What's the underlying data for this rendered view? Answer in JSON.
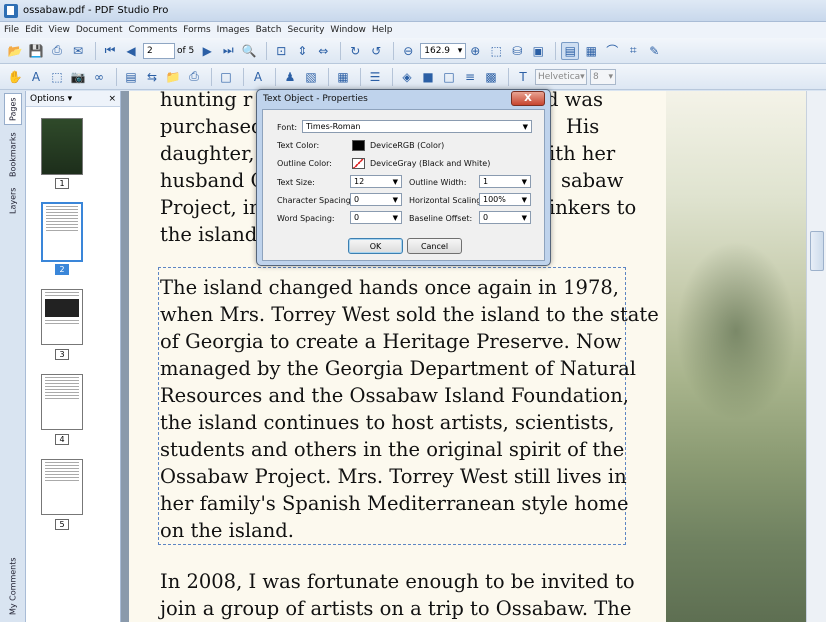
{
  "window": {
    "title": "ossabaw.pdf - PDF Studio Pro"
  },
  "menu": [
    "File",
    "Edit",
    "View",
    "Document",
    "Comments",
    "Forms",
    "Images",
    "Batch",
    "Security",
    "Window",
    "Help"
  ],
  "toolbar": {
    "page_current": "2",
    "page_of": "of 5",
    "zoom": "162.9",
    "font_name": "Helvetica",
    "font_size": "8"
  },
  "side_tabs": [
    "Pages",
    "Bookmarks",
    "Layers",
    "My Comments"
  ],
  "panel": {
    "options_label": "Options",
    "close_glyph": "×"
  },
  "thumbnails": [
    {
      "num": "1"
    },
    {
      "num": "2"
    },
    {
      "num": "3"
    },
    {
      "num": "4"
    },
    {
      "num": "5"
    }
  ],
  "document": {
    "top_lines": [
      "hunting r",
      "purchased",
      "daughter,",
      "husband C",
      "Project, in",
      "the island"
    ],
    "right_fragments": [
      "d was",
      "His",
      "ith her",
      "sabaw",
      "inkers to"
    ],
    "selected_lines": [
      "The island changed hands once again in 1978,",
      "when Mrs. Torrey West sold the island to the state",
      "of Georgia to create a Heritage Preserve. Now",
      "managed by the Georgia Department of Natural",
      "Resources and the Ossabaw Island Foundation,",
      "the island continues to host artists, scientists,",
      "students and others in the original spirit of the",
      "Ossabaw Project. Mrs. Torrey West still lives in",
      "her family's Spanish Mediterranean style home",
      "on the island."
    ],
    "bottom_lines": [
      "In 2008, I was fortunate enough to be invited to",
      "join a group of artists on a trip to Ossabaw. The"
    ]
  },
  "dialog": {
    "title": "Text Object - Properties",
    "close": "X",
    "font_label": "Font:",
    "font_value": "Times-Roman",
    "text_color_label": "Text Color:",
    "text_color_value": "DeviceRGB (Color)",
    "outline_color_label": "Outline Color:",
    "outline_color_value": "DeviceGray (Black and White)",
    "text_size_label": "Text Size:",
    "text_size_value": "12",
    "outline_width_label": "Outline Width:",
    "outline_width_value": "1",
    "char_spacing_label": "Character Spacing:",
    "char_spacing_value": "0",
    "h_scaling_label": "Horizontal Scaling:",
    "h_scaling_value": "100%",
    "word_spacing_label": "Word Spacing:",
    "word_spacing_value": "0",
    "baseline_label": "Baseline Offset:",
    "baseline_value": "0",
    "ok": "OK",
    "cancel": "Cancel"
  }
}
